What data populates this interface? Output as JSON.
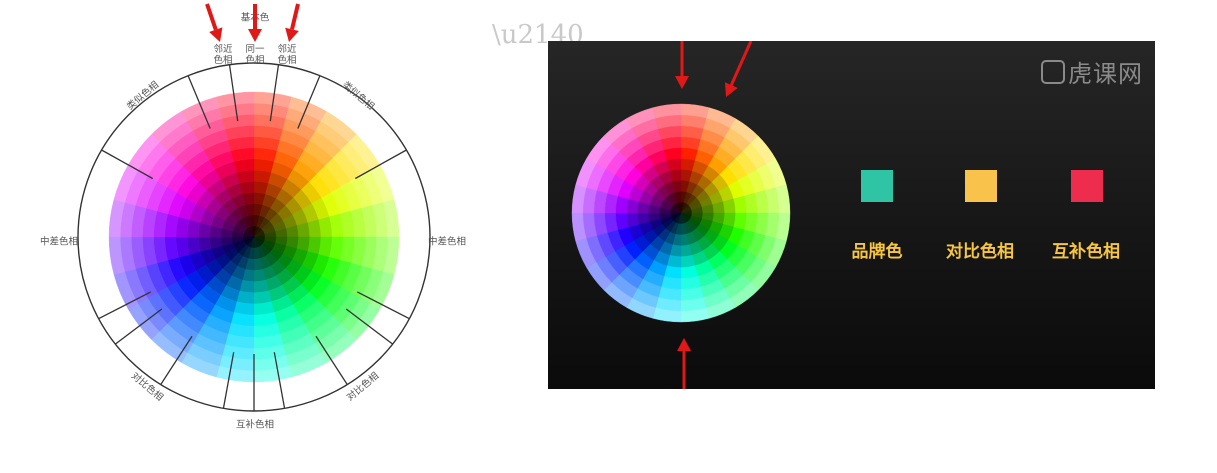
{
  "left_diagram": {
    "title": "基本色",
    "labels": {
      "adjacent_left": "邻近\n色相",
      "same": "同一\n色相",
      "adjacent_right": "邻近\n色相",
      "similar_left": "类似色相",
      "similar_right": "类似色相",
      "medium_left": "中差色相",
      "medium_right": "中差色相",
      "contrast_left": "对比色相",
      "contrast_right": "对比色相",
      "complementary": "互补色相"
    }
  },
  "right_panel": {
    "watermark": "虎课网",
    "swatches": [
      {
        "label": "品牌色",
        "color": "#2ec4a4"
      },
      {
        "label": "对比色相",
        "color": "#f9c24a"
      },
      {
        "label": "互补色相",
        "color": "#ee2d4e"
      }
    ]
  },
  "colors": {
    "arrow": "#e01818",
    "label_text": "#555555",
    "panel_bg": "#1b1b1b"
  },
  "icons": [
    "arrow-down-icon",
    "arrow-up-icon",
    "watermark-logo-icon"
  ]
}
